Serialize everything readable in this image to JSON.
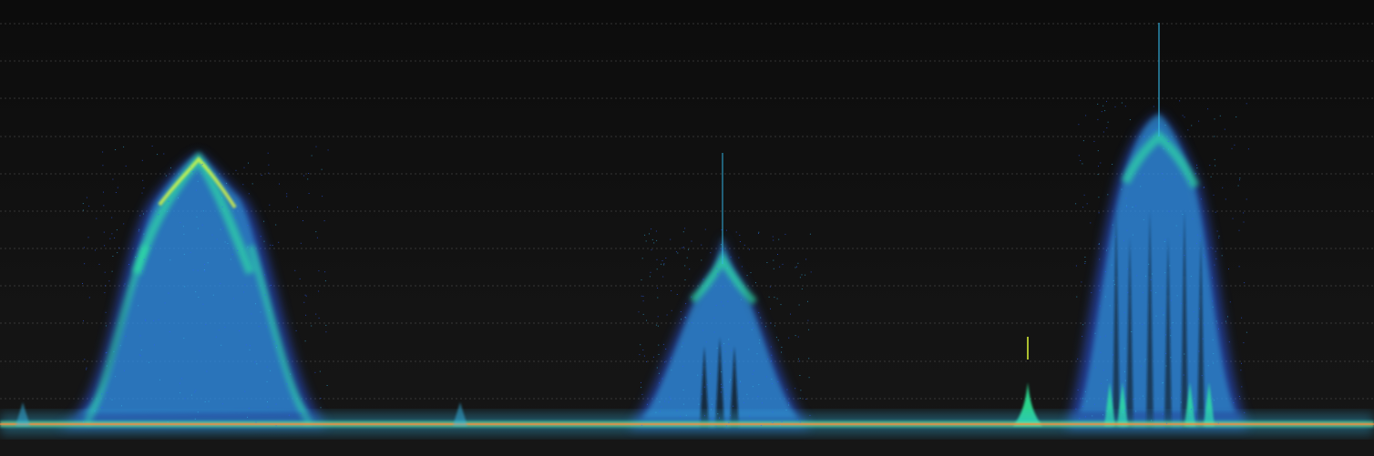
{
  "app": {
    "view": "spectrum-persistence-display"
  },
  "colors": {
    "background": "#121212",
    "grid": "#6a6a6a",
    "persistence_low": "#2f5fff",
    "persistence_mid": "#35b8e8",
    "persistence_high": "#2ff5a0",
    "persistence_peak": "#e6ff3a",
    "noise_floor_core": "#ff8a3d"
  },
  "display": {
    "grid_lines": 11,
    "grid_style": "dashed"
  }
}
